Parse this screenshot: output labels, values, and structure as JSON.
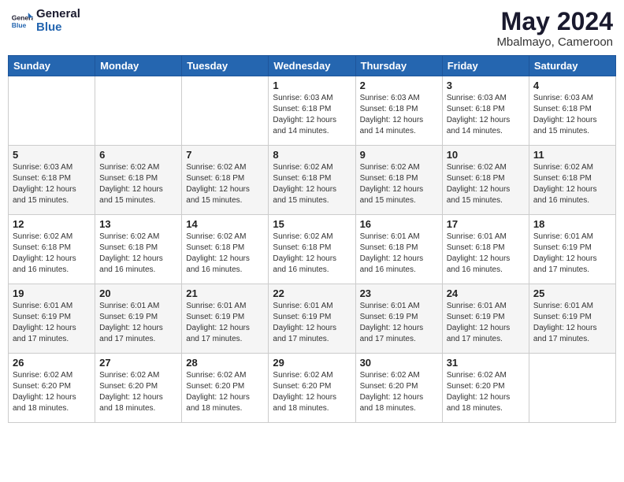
{
  "header": {
    "logo_line1": "General",
    "logo_line2": "Blue",
    "month_year": "May 2024",
    "location": "Mbalmayo, Cameroon"
  },
  "weekdays": [
    "Sunday",
    "Monday",
    "Tuesday",
    "Wednesday",
    "Thursday",
    "Friday",
    "Saturday"
  ],
  "weeks": [
    [
      {
        "day": "",
        "sunrise": "",
        "sunset": "",
        "daylight": ""
      },
      {
        "day": "",
        "sunrise": "",
        "sunset": "",
        "daylight": ""
      },
      {
        "day": "",
        "sunrise": "",
        "sunset": "",
        "daylight": ""
      },
      {
        "day": "1",
        "sunrise": "Sunrise: 6:03 AM",
        "sunset": "Sunset: 6:18 PM",
        "daylight": "Daylight: 12 hours and 14 minutes."
      },
      {
        "day": "2",
        "sunrise": "Sunrise: 6:03 AM",
        "sunset": "Sunset: 6:18 PM",
        "daylight": "Daylight: 12 hours and 14 minutes."
      },
      {
        "day": "3",
        "sunrise": "Sunrise: 6:03 AM",
        "sunset": "Sunset: 6:18 PM",
        "daylight": "Daylight: 12 hours and 14 minutes."
      },
      {
        "day": "4",
        "sunrise": "Sunrise: 6:03 AM",
        "sunset": "Sunset: 6:18 PM",
        "daylight": "Daylight: 12 hours and 15 minutes."
      }
    ],
    [
      {
        "day": "5",
        "sunrise": "Sunrise: 6:03 AM",
        "sunset": "Sunset: 6:18 PM",
        "daylight": "Daylight: 12 hours and 15 minutes."
      },
      {
        "day": "6",
        "sunrise": "Sunrise: 6:02 AM",
        "sunset": "Sunset: 6:18 PM",
        "daylight": "Daylight: 12 hours and 15 minutes."
      },
      {
        "day": "7",
        "sunrise": "Sunrise: 6:02 AM",
        "sunset": "Sunset: 6:18 PM",
        "daylight": "Daylight: 12 hours and 15 minutes."
      },
      {
        "day": "8",
        "sunrise": "Sunrise: 6:02 AM",
        "sunset": "Sunset: 6:18 PM",
        "daylight": "Daylight: 12 hours and 15 minutes."
      },
      {
        "day": "9",
        "sunrise": "Sunrise: 6:02 AM",
        "sunset": "Sunset: 6:18 PM",
        "daylight": "Daylight: 12 hours and 15 minutes."
      },
      {
        "day": "10",
        "sunrise": "Sunrise: 6:02 AM",
        "sunset": "Sunset: 6:18 PM",
        "daylight": "Daylight: 12 hours and 15 minutes."
      },
      {
        "day": "11",
        "sunrise": "Sunrise: 6:02 AM",
        "sunset": "Sunset: 6:18 PM",
        "daylight": "Daylight: 12 hours and 16 minutes."
      }
    ],
    [
      {
        "day": "12",
        "sunrise": "Sunrise: 6:02 AM",
        "sunset": "Sunset: 6:18 PM",
        "daylight": "Daylight: 12 hours and 16 minutes."
      },
      {
        "day": "13",
        "sunrise": "Sunrise: 6:02 AM",
        "sunset": "Sunset: 6:18 PM",
        "daylight": "Daylight: 12 hours and 16 minutes."
      },
      {
        "day": "14",
        "sunrise": "Sunrise: 6:02 AM",
        "sunset": "Sunset: 6:18 PM",
        "daylight": "Daylight: 12 hours and 16 minutes."
      },
      {
        "day": "15",
        "sunrise": "Sunrise: 6:02 AM",
        "sunset": "Sunset: 6:18 PM",
        "daylight": "Daylight: 12 hours and 16 minutes."
      },
      {
        "day": "16",
        "sunrise": "Sunrise: 6:01 AM",
        "sunset": "Sunset: 6:18 PM",
        "daylight": "Daylight: 12 hours and 16 minutes."
      },
      {
        "day": "17",
        "sunrise": "Sunrise: 6:01 AM",
        "sunset": "Sunset: 6:18 PM",
        "daylight": "Daylight: 12 hours and 16 minutes."
      },
      {
        "day": "18",
        "sunrise": "Sunrise: 6:01 AM",
        "sunset": "Sunset: 6:19 PM",
        "daylight": "Daylight: 12 hours and 17 minutes."
      }
    ],
    [
      {
        "day": "19",
        "sunrise": "Sunrise: 6:01 AM",
        "sunset": "Sunset: 6:19 PM",
        "daylight": "Daylight: 12 hours and 17 minutes."
      },
      {
        "day": "20",
        "sunrise": "Sunrise: 6:01 AM",
        "sunset": "Sunset: 6:19 PM",
        "daylight": "Daylight: 12 hours and 17 minutes."
      },
      {
        "day": "21",
        "sunrise": "Sunrise: 6:01 AM",
        "sunset": "Sunset: 6:19 PM",
        "daylight": "Daylight: 12 hours and 17 minutes."
      },
      {
        "day": "22",
        "sunrise": "Sunrise: 6:01 AM",
        "sunset": "Sunset: 6:19 PM",
        "daylight": "Daylight: 12 hours and 17 minutes."
      },
      {
        "day": "23",
        "sunrise": "Sunrise: 6:01 AM",
        "sunset": "Sunset: 6:19 PM",
        "daylight": "Daylight: 12 hours and 17 minutes."
      },
      {
        "day": "24",
        "sunrise": "Sunrise: 6:01 AM",
        "sunset": "Sunset: 6:19 PM",
        "daylight": "Daylight: 12 hours and 17 minutes."
      },
      {
        "day": "25",
        "sunrise": "Sunrise: 6:01 AM",
        "sunset": "Sunset: 6:19 PM",
        "daylight": "Daylight: 12 hours and 17 minutes."
      }
    ],
    [
      {
        "day": "26",
        "sunrise": "Sunrise: 6:02 AM",
        "sunset": "Sunset: 6:20 PM",
        "daylight": "Daylight: 12 hours and 18 minutes."
      },
      {
        "day": "27",
        "sunrise": "Sunrise: 6:02 AM",
        "sunset": "Sunset: 6:20 PM",
        "daylight": "Daylight: 12 hours and 18 minutes."
      },
      {
        "day": "28",
        "sunrise": "Sunrise: 6:02 AM",
        "sunset": "Sunset: 6:20 PM",
        "daylight": "Daylight: 12 hours and 18 minutes."
      },
      {
        "day": "29",
        "sunrise": "Sunrise: 6:02 AM",
        "sunset": "Sunset: 6:20 PM",
        "daylight": "Daylight: 12 hours and 18 minutes."
      },
      {
        "day": "30",
        "sunrise": "Sunrise: 6:02 AM",
        "sunset": "Sunset: 6:20 PM",
        "daylight": "Daylight: 12 hours and 18 minutes."
      },
      {
        "day": "31",
        "sunrise": "Sunrise: 6:02 AM",
        "sunset": "Sunset: 6:20 PM",
        "daylight": "Daylight: 12 hours and 18 minutes."
      },
      {
        "day": "",
        "sunrise": "",
        "sunset": "",
        "daylight": ""
      }
    ]
  ]
}
